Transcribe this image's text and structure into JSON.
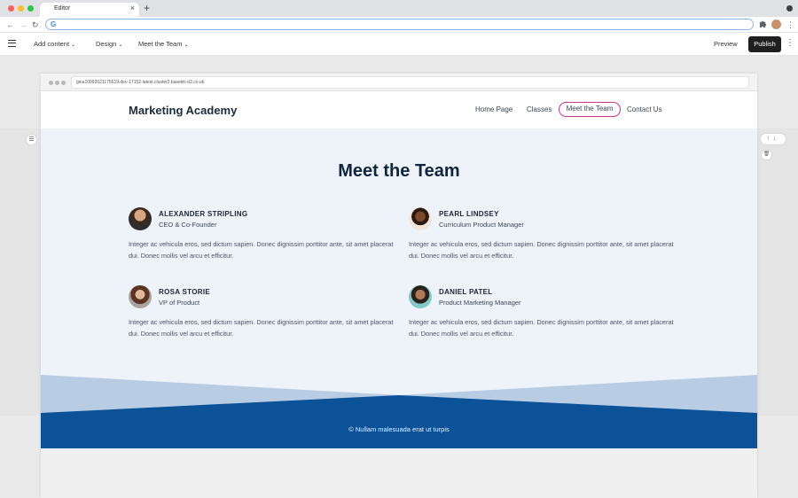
{
  "browser": {
    "tab_title": "Editor",
    "tab_close": "×",
    "new_tab": "+",
    "address": "G",
    "nav": {
      "back": "←",
      "forward": "→",
      "reload": "↻"
    },
    "extensions_icon": "puzzle-icon",
    "menu_glyph": "⋮",
    "traffic_colors": [
      "#ff5f57",
      "#febc2e",
      "#28c840"
    ]
  },
  "toolbar": {
    "add_content": "Add content",
    "design": "Design",
    "page_select": "Meet the Team",
    "chevron": "⌄",
    "preview": "Preview",
    "publish": "Publish",
    "menu_glyph": "⋮"
  },
  "canvas_controls": {
    "section_settings_glyph": "☰",
    "move_up_down": "↑↓",
    "delete_glyph": "🗑"
  },
  "site": {
    "url": "gina10092021175619.dev-17152-latest.cluster2.basekit-ci2.co.uk",
    "brand": "Marketing Academy",
    "nav": [
      "Home Page",
      "Classes",
      "Meet the Team",
      "Contact Us"
    ],
    "active_nav_index": 2,
    "accent_color": "#c6348f",
    "section_title": "Meet the Team",
    "members": [
      {
        "name": "ALEXANDER STRIPLING",
        "role": "CEO & Co-Founder",
        "bio": "Integer ac vehicula eros, sed dictum sapien. Donec dignissim porttitor ante, sit amet placerat dui. Donec mollis vel arcu et efficitur."
      },
      {
        "name": "PEARL LINDSEY",
        "role": "Curriculum Product Manager",
        "bio": "Integer ac vehicula eros, sed dictum sapien. Donec dignissim porttitor ante, sit amet placerat dui. Donec mollis vel arcu et efficitur."
      },
      {
        "name": "ROSA STORIE",
        "role": "VP of Product",
        "bio": "Integer ac vehicula eros, sed dictum sapien. Donec dignissim porttitor ante, sit amet placerat dui. Donec mollis vel arcu et efficitur."
      },
      {
        "name": "DANIEL PATEL",
        "role": "Product Marketing Manager",
        "bio": "Integer ac vehicula eros, sed dictum sapien. Donec dignissim porttitor ante, sit amet placerat dui. Donec mollis vel arcu et efficitur."
      }
    ],
    "footer_text": "© Nullam malesuada erat ut turpis",
    "footer_color": "#0b5299"
  }
}
